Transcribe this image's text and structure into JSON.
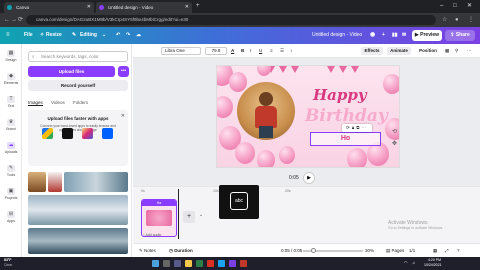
{
  "browser": {
    "tabs": [
      {
        "label": "Canva",
        "active": false
      },
      {
        "label": "Untitled design - Video",
        "active": true
      }
    ],
    "new_tab": "+",
    "url": "canva.com/design/DAG2uBX1M9b/V3kCrp4SY5f9bx4bMbtCrgg/edit?ui=e30"
  },
  "topbar": {
    "file": "File",
    "resize": "Resize",
    "editing": "Editing",
    "doc_title": "Untitled design - Video",
    "preview": "Preview",
    "share": "Share"
  },
  "rail": [
    {
      "label": "Design",
      "icon": "design-icon"
    },
    {
      "label": "Elements",
      "icon": "elements-icon"
    },
    {
      "label": "Text",
      "icon": "text-icon"
    },
    {
      "label": "Brand",
      "icon": "brand-icon"
    },
    {
      "label": "Uploads",
      "icon": "upload-icon"
    },
    {
      "label": "Tools",
      "icon": "tools-icon"
    },
    {
      "label": "Projects",
      "icon": "projects-icon"
    },
    {
      "label": "Apps",
      "icon": "apps-icon"
    }
  ],
  "panel": {
    "search_placeholder": "Search keywords, tags, color",
    "upload_files": "Upload files",
    "more": "•••",
    "record": "Record yourself",
    "tabs": [
      "Images",
      "Videos",
      "Folders"
    ],
    "promo_title": "Upload files faster with apps",
    "promo_desc": "Connect your most-loved apps to easily browse and upload files cloud storage",
    "promo_close": "✕"
  },
  "toolbar": {
    "font": "Libra One",
    "size": "79.9",
    "effects": "Effects",
    "animate": "Animate",
    "position": "Position"
  },
  "design": {
    "line1": "Happy",
    "line2": "Birthday",
    "name_text": "Ho"
  },
  "playback": {
    "time": "0:05",
    "play": "▶"
  },
  "timeline": {
    "clip_label": "Ha",
    "add_audio": "Add audio",
    "add": "+",
    "text_icon_label": "abc",
    "ruler": [
      "0s",
      "10s",
      "20s"
    ]
  },
  "bottom": {
    "notes": "Notes",
    "duration": "Duration",
    "timecode": "0:05 / 0:05",
    "zoom": "30%",
    "pages": "Pages",
    "page_count": "1/1"
  },
  "activation": {
    "title": "Activate Windows",
    "sub": "Go to Settings to activate Windows."
  },
  "taskbar": {
    "weather_temp": "83°F",
    "weather_desc": "Clear",
    "time": "4:20 PM",
    "date": "10/24/2021"
  },
  "colors": {
    "accent": "#8b3dff",
    "pink": "#d9387f"
  }
}
